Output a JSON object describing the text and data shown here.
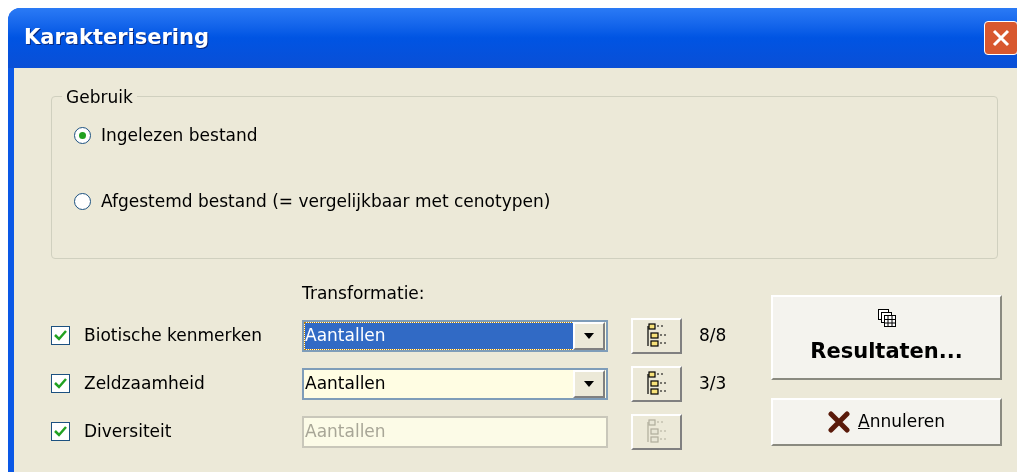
{
  "window": {
    "title": "Karakterisering"
  },
  "usage_group": {
    "title": "Gebruik",
    "options": [
      {
        "label": "Ingelezen bestand",
        "selected": true
      },
      {
        "label": "Afgestemd bestand (= vergelijkbaar met cenotypen)",
        "selected": false
      }
    ]
  },
  "transformation_label": "Transformatie:",
  "rows": [
    {
      "label": "Biotische kenmerken",
      "checked": true,
      "value": "Aantallen",
      "focused": true,
      "disabled": false,
      "count": "8/8"
    },
    {
      "label": "Zeldzaamheid",
      "checked": true,
      "value": "Aantallen",
      "focused": false,
      "disabled": false,
      "count": "3/3"
    },
    {
      "label": "Diversiteit",
      "checked": true,
      "value": "Aantallen",
      "focused": false,
      "disabled": true
    }
  ],
  "buttons": [
    {
      "kind": "results",
      "label": "Resultaten..."
    },
    {
      "kind": "cancel",
      "label": "Annuleren",
      "mnemonic_first": true
    }
  ]
}
